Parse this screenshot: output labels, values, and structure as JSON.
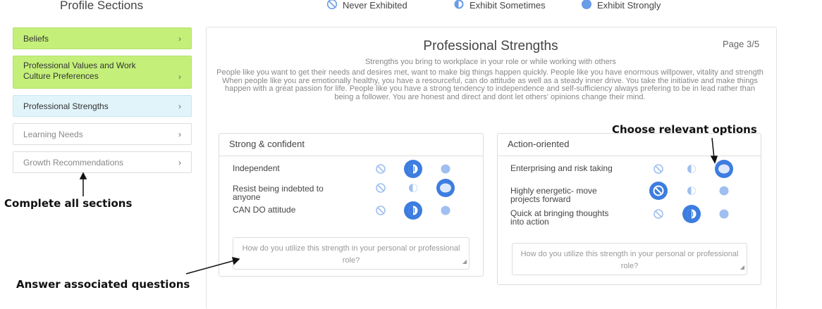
{
  "sidebar": {
    "title": "Profile Sections",
    "items": [
      {
        "label": "Beliefs",
        "chevron": "chevron-right-icon"
      },
      {
        "label": "Professional Values and Work Culture Preferences",
        "chevron": "chevron-right-icon"
      },
      {
        "label": "Professional Strengths",
        "chevron": "chevron-right-icon"
      },
      {
        "label": "Learning Needs",
        "chevron": "chevron-right-icon"
      },
      {
        "label": "Growth Recommendations",
        "chevron": "chevron-right-icon"
      }
    ]
  },
  "legend": {
    "never": "Never Exhibited",
    "sometimes": "Exhibit Sometimes",
    "strongly": "Exhibit Strongly"
  },
  "panel": {
    "title": "Professional Strengths",
    "page": "Page 3/5",
    "subtitle": "Strengths you bring to workplace in your role or while working with others",
    "description": "People like you want to get their needs and desires met, want to make big things happen quickly. People like you have enormous willpower, vitality and strength When people like you are emotionally healthy, you have a resourceful, can do attitude as well as a steady inner drive. You take the initiative and make things happen with a great passion for life. People like you have a strong tendency to independence and self-sufficiency always prefering to be in lead rather than being a follower. You are honest and direct and dont let others' opinions change their mind."
  },
  "cards": [
    {
      "title": "Strong & confident",
      "traits": [
        {
          "label": "Independent",
          "selected": "sometimes"
        },
        {
          "label": "Resist being indebted to anyone",
          "selected": "strongly"
        },
        {
          "label": "CAN DO attitude",
          "selected": "sometimes"
        }
      ],
      "question_placeholder": "How do you utilize this strength in your personal or professional role?"
    },
    {
      "title": "Action-oriented",
      "traits": [
        {
          "label": "Enterprising and risk taking",
          "selected": "strongly"
        },
        {
          "label": "Highly energetic- move projects forward",
          "selected": "never"
        },
        {
          "label": "Quick at bringing thoughts into action",
          "selected": "sometimes"
        }
      ],
      "question_placeholder": "How do you utilize this strength in your personal or professional role?"
    }
  ],
  "annotations": {
    "choose": "Choose relevant options",
    "complete": "Complete all sections",
    "answer": "Answer associated questions"
  },
  "colors": {
    "accent": "#3d7de0",
    "light_accent": "#9fbff0",
    "green_item": "#c4f07a",
    "blue_item": "#e0f4fa"
  }
}
